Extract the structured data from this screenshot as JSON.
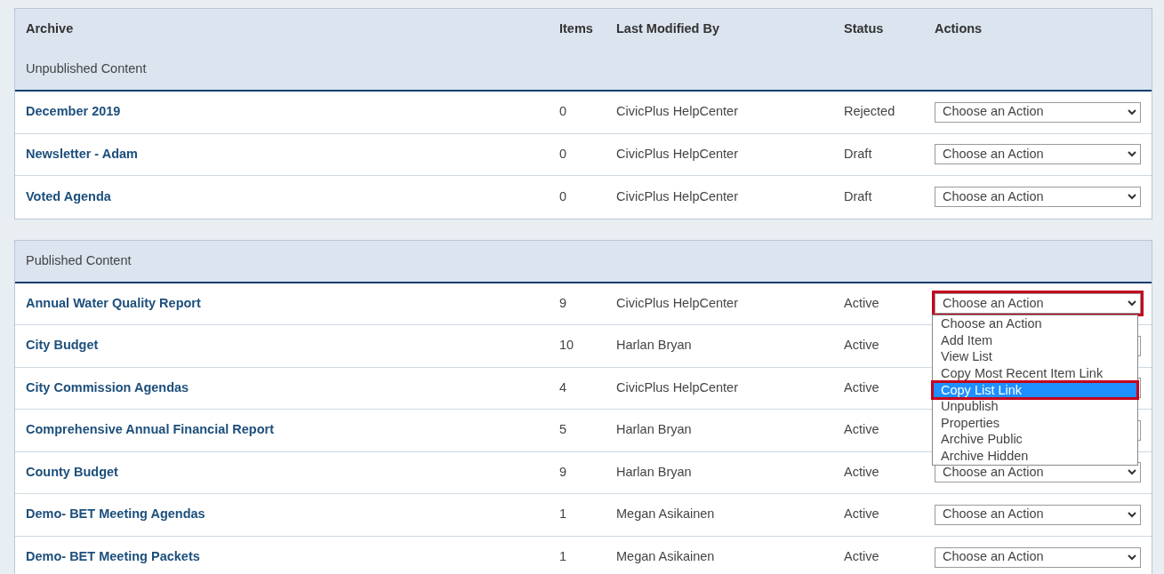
{
  "sections": [
    {
      "columns": [
        "Archive",
        "Items",
        "Last Modified By",
        "Status",
        "Actions"
      ],
      "title": "Unpublished Content",
      "rows": [
        {
          "name": "December 2019",
          "items": "0",
          "modified_by": "CivicPlus HelpCenter",
          "status": "Rejected",
          "action": "Choose an Action"
        },
        {
          "name": "Newsletter - Adam",
          "items": "0",
          "modified_by": "CivicPlus HelpCenter",
          "status": "Draft",
          "action": "Choose an Action"
        },
        {
          "name": "Voted Agenda",
          "items": "0",
          "modified_by": "CivicPlus HelpCenter",
          "status": "Draft",
          "action": "Choose an Action"
        }
      ]
    },
    {
      "title": "Published Content",
      "rows": [
        {
          "name": "Annual Water Quality Report",
          "items": "9",
          "modified_by": "CivicPlus HelpCenter",
          "status": "Active",
          "action": "Choose an Action",
          "open": true,
          "highlighted": true,
          "options": [
            {
              "label": "Choose an Action",
              "selected": false,
              "highlighted": false
            },
            {
              "label": "Add Item",
              "selected": false,
              "highlighted": false
            },
            {
              "label": "View List",
              "selected": false,
              "highlighted": false
            },
            {
              "label": "Copy Most Recent Item Link",
              "selected": false,
              "highlighted": false
            },
            {
              "label": "Copy List Link",
              "selected": true,
              "highlighted": true
            },
            {
              "label": "Unpublish",
              "selected": false,
              "highlighted": false
            },
            {
              "label": "Properties",
              "selected": false,
              "highlighted": false
            },
            {
              "label": "Archive Public",
              "selected": false,
              "highlighted": false
            },
            {
              "label": "Archive Hidden",
              "selected": false,
              "highlighted": false
            }
          ]
        },
        {
          "name": "City Budget",
          "items": "10",
          "modified_by": "Harlan Bryan",
          "status": "Active"
        },
        {
          "name": "City Commission Agendas",
          "items": "4",
          "modified_by": "CivicPlus HelpCenter",
          "status": "Active"
        },
        {
          "name": "Comprehensive Annual Financial Report",
          "items": "5",
          "modified_by": "Harlan Bryan",
          "status": "Active"
        },
        {
          "name": "County Budget",
          "items": "9",
          "modified_by": "Harlan Bryan",
          "status": "Active",
          "action": "Choose an Action"
        },
        {
          "name": "Demo- BET Meeting Agendas",
          "items": "1",
          "modified_by": "Megan Asikainen",
          "status": "Active",
          "action": "Choose an Action"
        },
        {
          "name": "Demo- BET Meeting Packets",
          "items": "1",
          "modified_by": "Megan Asikainen",
          "status": "Active",
          "action": "Choose an Action"
        }
      ]
    }
  ]
}
